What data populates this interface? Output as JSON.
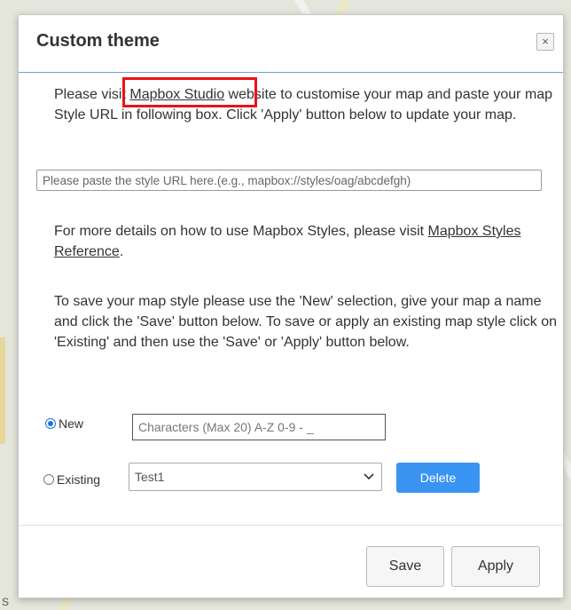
{
  "dialog": {
    "title": "Custom theme",
    "close_label": "×",
    "para1_prefix": "Please visit ",
    "mapbox_studio_link": "Mapbox Studio",
    "para1_suffix": " website to customise your map and paste your map Style URL in following box. Click 'Apply' button below to update your map.",
    "url_placeholder": "Please paste the style URL here.(e.g., mapbox://styles/oag/abcdefgh)",
    "para2_prefix": "For more details on how to use Mapbox Styles, please visit ",
    "styles_reference_link": "Mapbox Styles Reference",
    "para2_suffix": ".",
    "para3": "To save your map style please use the 'New' selection, give your map a name and click the 'Save' button below. To save or apply an existing map style click on 'Existing' and then use the 'Save' or 'Apply' button below.",
    "radio_new_label": "New",
    "name_placeholder": "Characters (Max 20) A-Z 0-9 - _",
    "radio_existing_label": "Existing",
    "existing_selected": "Test1",
    "delete_label": "Delete",
    "save_label": "Save",
    "apply_label": "Apply"
  },
  "map": {
    "corner_label": "S"
  },
  "colors": {
    "accent": "#3a94f2",
    "highlight": "#e8131b",
    "header_line": "#6aa3d8"
  }
}
